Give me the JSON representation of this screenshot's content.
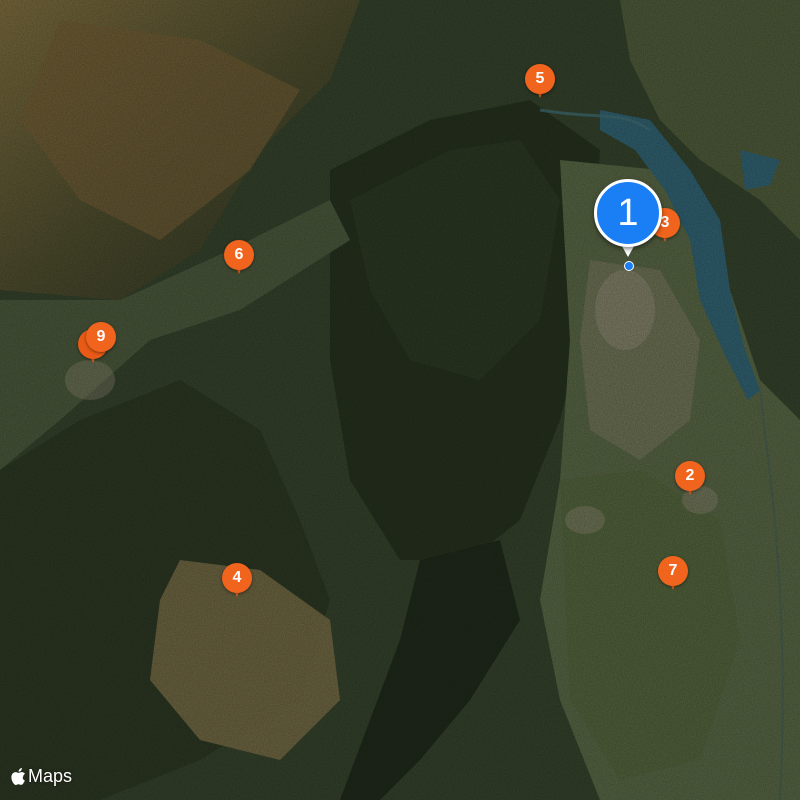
{
  "map": {
    "style": "satellite",
    "logo_text": "Maps",
    "colors": {
      "pin": "#f0641d",
      "selected_pin": "#1a7ff5",
      "lake": "#2f5f6e",
      "forest": "#2c3a22",
      "farmland": "#5d6a45"
    }
  },
  "selected_marker": {
    "label": "1"
  },
  "markers": [
    {
      "label": "3",
      "state": "behind-selected"
    },
    {
      "label": "2"
    },
    {
      "label": "4"
    },
    {
      "label": "5"
    },
    {
      "label": "6"
    },
    {
      "label": "7"
    },
    {
      "label": "8",
      "state": "clustered-behind-9"
    },
    {
      "label": "9"
    }
  ]
}
